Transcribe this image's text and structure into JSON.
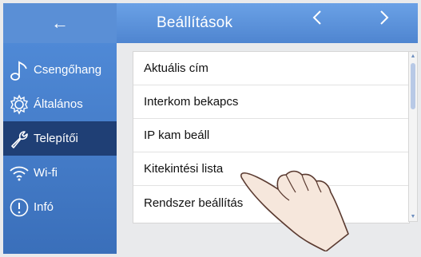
{
  "header": {
    "back_icon": "←",
    "title": "Beállítások",
    "prev_icon": "‹",
    "next_icon": "›"
  },
  "sidebar": {
    "items": [
      {
        "label": "Csengőhang",
        "icon": "music-note-icon",
        "active": false
      },
      {
        "label": "Általános",
        "icon": "gear-icon",
        "active": false
      },
      {
        "label": "Telepítői",
        "icon": "wrench-icon",
        "active": true
      },
      {
        "label": "Wi-fi",
        "icon": "wifi-icon",
        "active": false
      },
      {
        "label": "Infó",
        "icon": "info-icon",
        "active": false
      }
    ]
  },
  "list": {
    "items": [
      "Aktuális cím",
      "Interkom bekapcs",
      "IP kam beáll",
      "Kitekintési lista",
      "Rendszer beállítás"
    ]
  },
  "colors": {
    "header_blue": "#5a8fd6",
    "sidebar_blue": "#4f89d6",
    "active_item": "#1f3f75"
  }
}
